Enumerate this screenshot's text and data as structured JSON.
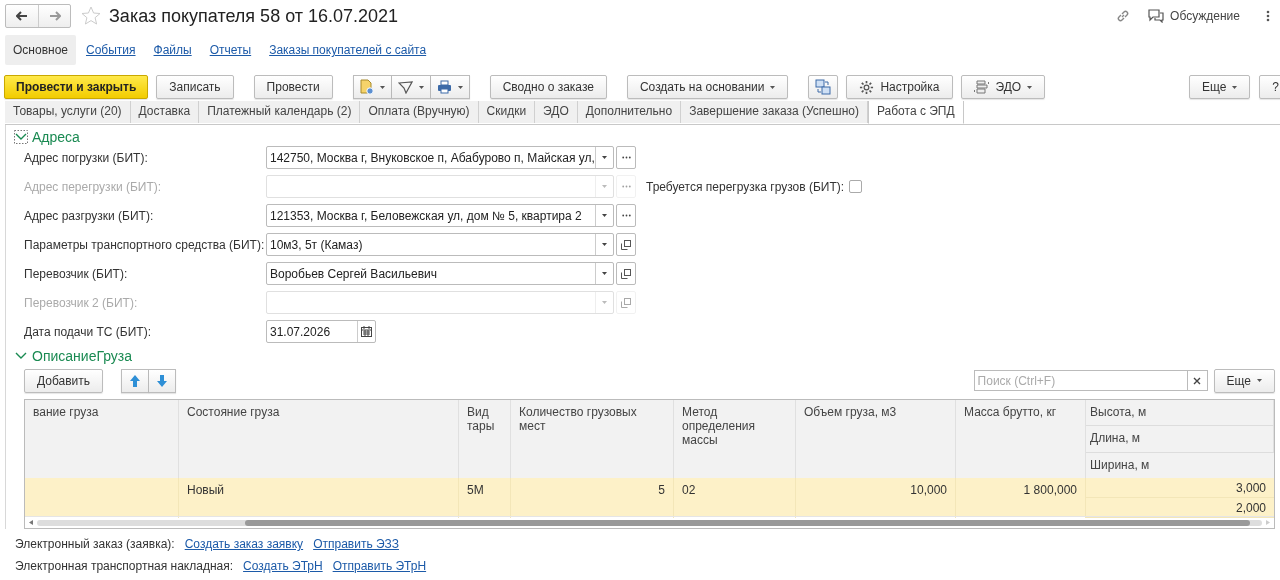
{
  "window": {
    "title": "Заказ покупателя 58 от 16.07.2021",
    "discussion": "Обсуждение"
  },
  "nav": [
    {
      "label": "Основное",
      "selected": true
    },
    {
      "label": "События",
      "selected": false
    },
    {
      "label": "Файлы",
      "selected": false
    },
    {
      "label": "Отчеты",
      "selected": false
    },
    {
      "label": "Заказы покупателей с сайта",
      "selected": false
    }
  ],
  "toolbar": [
    {
      "kind": "primary",
      "label": "Провести и закрыть"
    },
    {
      "kind": "button",
      "label": "Записать"
    },
    {
      "kind": "button",
      "label": "Провести"
    },
    {
      "kind": "icon-group"
    },
    {
      "kind": "button",
      "label": "Сводно о заказе"
    },
    {
      "kind": "dropdown",
      "label": "Создать на основании"
    },
    {
      "kind": "structure"
    },
    {
      "kind": "settings",
      "label": "Настройка"
    },
    {
      "kind": "edo",
      "label": "ЭДО"
    }
  ],
  "toolbar_right": [
    {
      "kind": "dropdown",
      "label": "Еще"
    },
    {
      "kind": "button",
      "label": "?"
    }
  ],
  "tabs": [
    {
      "label": "Товары, услуги (20)",
      "selected": false
    },
    {
      "label": "Доставка",
      "selected": false
    },
    {
      "label": "Платежный календарь (2)",
      "selected": false
    },
    {
      "label": "Оплата (Вручную)",
      "selected": false
    },
    {
      "label": "Скидки",
      "selected": false
    },
    {
      "label": "ЭДО",
      "selected": false
    },
    {
      "label": "Дополнительно",
      "selected": false
    },
    {
      "label": "Завершение заказа (Успешно)",
      "selected": false
    },
    {
      "label": "Работа с ЭПД",
      "selected": true
    }
  ],
  "addresses": {
    "title": "Адреса",
    "expanded": true,
    "fields": [
      {
        "kind": "select-ellipsis",
        "label": "Адрес погрузки (БИТ):",
        "value": "142750, Москва г, Внуковское п, Абабурово п, Майская ул,",
        "disabled": false
      },
      {
        "kind": "select-ellipsis",
        "label": "Адрес перегрузки (БИТ):",
        "disabled": true,
        "checkbox": {
          "label": "Требуется перегрузка грузов (БИТ):",
          "checked": false
        }
      },
      {
        "kind": "select-ellipsis",
        "label": "Адрес разгрузки (БИТ):",
        "value": "121353, Москва г, Беловежская ул, дом № 5, квартира 2",
        "disabled": false
      },
      {
        "kind": "select-open",
        "label": "Параметры транспортного средства (БИТ):",
        "value": "10м3, 5т (Камаз)",
        "disabled": false
      },
      {
        "kind": "select-open",
        "label": "Перевозчик (БИТ):",
        "value": "Воробьев Сергей Васильевич",
        "disabled": false
      },
      {
        "kind": "select-open",
        "label": "Перевозчик 2 (БИТ):",
        "disabled": true
      },
      {
        "kind": "date",
        "label": "Дата подачи ТС (БИТ):",
        "value": "31.07.2026",
        "disabled": false
      }
    ]
  },
  "cargo": {
    "title": "ОписаниеГруза",
    "expanded": true,
    "add_button": "Добавить",
    "search": {
      "placeholder": "Поиск (Ctrl+F)"
    },
    "more_button": "Еще",
    "columns": [
      "вание груза",
      "Состояние груза",
      "Вид тары",
      "Количество грузовых мест",
      "Метод определения массы",
      "Объем груза, м3",
      "Масса брутто, кг"
    ],
    "stacked_column": [
      "Высота, м",
      "Длина, м",
      "Ширина, м"
    ],
    "rows": [
      {
        "selected": true,
        "cells": [
          null,
          "Новый",
          "5М",
          "5",
          "02",
          "10,000",
          "1 800,000"
        ],
        "stacked": [
          "3,000",
          "2,000"
        ]
      }
    ]
  },
  "footer": [
    {
      "label": "Электронный заказ (заявка):",
      "links": [
        "Создать заказ заявку",
        "Отправить ЭЗЗ"
      ]
    },
    {
      "label": "Электронная транспортная накладная:",
      "links": [
        "Создать ЭТрН",
        "Отправить ЭТрН"
      ]
    }
  ]
}
